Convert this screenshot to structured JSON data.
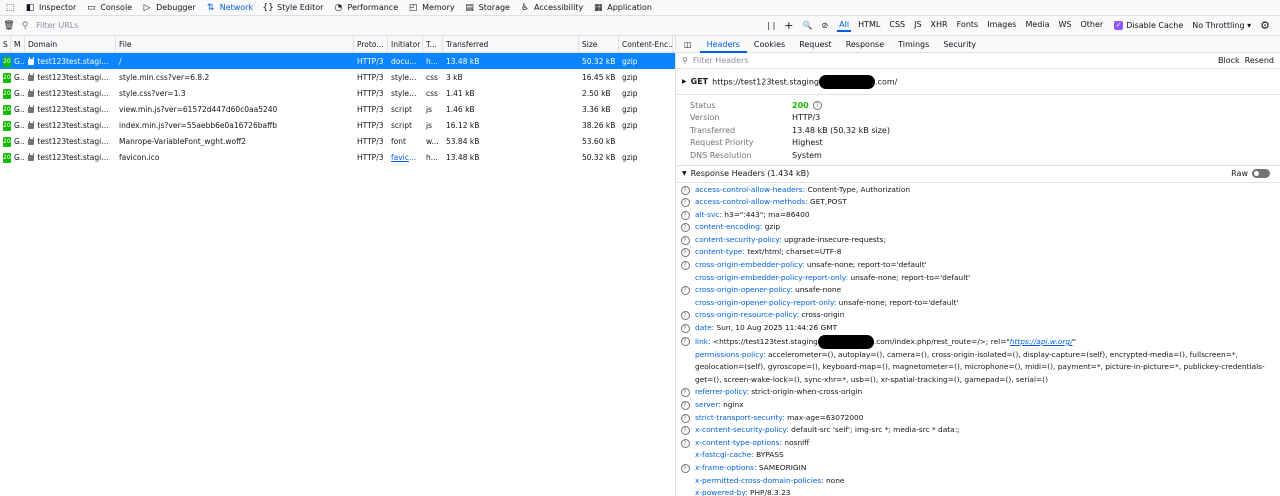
{
  "toolbar": {
    "items": [
      {
        "icon": "pick-element-icon",
        "label": ""
      },
      {
        "icon": "inspector-icon",
        "label": "Inspector"
      },
      {
        "icon": "console-icon",
        "label": "Console"
      },
      {
        "icon": "debugger-icon",
        "label": "Debugger"
      },
      {
        "icon": "network-icon",
        "label": "Network",
        "selected": true
      },
      {
        "icon": "style-editor-icon",
        "label": "Style Editor"
      },
      {
        "icon": "performance-icon",
        "label": "Performance"
      },
      {
        "icon": "memory-icon",
        "label": "Memory"
      },
      {
        "icon": "storage-icon",
        "label": "Storage"
      },
      {
        "icon": "accessibility-icon",
        "label": "Accessibility"
      },
      {
        "icon": "application-icon",
        "label": "Application"
      }
    ]
  },
  "filter": {
    "placeholder": "Filter URLs",
    "types": [
      "All",
      "HTML",
      "CSS",
      "JS",
      "XHR",
      "Fonts",
      "Images",
      "Media",
      "WS",
      "Other"
    ],
    "selected": "All",
    "disable_cache": "Disable Cache",
    "throttling": "No Throttling"
  },
  "table": {
    "columns": [
      "S",
      "M",
      "Domain",
      "File",
      "Proto...",
      "Initiator",
      "T...",
      "Transferred",
      "Size",
      "Content-Enc..."
    ],
    "rows": [
      [
        "200",
        "GET",
        "test123test.staging....",
        "/",
        "HTTP/3",
        "docu...",
        "h...",
        "13.48 kB",
        "50.32 kB",
        "gzip"
      ],
      [
        "200",
        "GET",
        "test123test.staging....",
        "style.min.css?ver=6.8.2",
        "HTTP/3",
        "styles...",
        "css",
        "3 kB",
        "16.45 kB",
        "gzip"
      ],
      [
        "200",
        "GET",
        "test123test.staging....",
        "style.css?ver=1.3",
        "HTTP/3",
        "styles...",
        "css",
        "1.41 kB",
        "2.50 kB",
        "gzip"
      ],
      [
        "200",
        "GET",
        "test123test.staging....",
        "view.min.js?ver=61572d447d60c0aa5240",
        "HTTP/3",
        "script",
        "js",
        "1.46 kB",
        "3.36 kB",
        "gzip"
      ],
      [
        "200",
        "GET",
        "test123test.staging....",
        "index.min.js?ver=55aebb6e0a16726baffb",
        "HTTP/3",
        "script",
        "js",
        "16.12 kB",
        "38.26 kB",
        "gzip"
      ],
      [
        "200",
        "GET",
        "test123test.staging....",
        "Manrope-VariableFont_wght.woff2",
        "HTTP/3",
        "font",
        "w...",
        "53.84 kB",
        "53.60 kB",
        ""
      ],
      [
        "200",
        "GET",
        "test123test.staging....",
        "favicon.ico",
        "HTTP/3",
        "favico...",
        "h...",
        "13.48 kB",
        "50.32 kB",
        "gzip"
      ]
    ]
  },
  "details": {
    "tabs": [
      "Headers",
      "Cookies",
      "Request",
      "Response",
      "Timings",
      "Security"
    ],
    "filter_placeholder": "Filter Headers",
    "block": "Block",
    "resend": "Resend",
    "method": "GET",
    "url_start": "https://test123test.staging",
    "url_end": ".com/",
    "summary": [
      {
        "k": "Status",
        "v": "200"
      },
      {
        "k": "Version",
        "v": "HTTP/3"
      },
      {
        "k": "Transferred",
        "v": "13.48 kB (50.32 kB size)"
      },
      {
        "k": "Request Priority",
        "v": "Highest"
      },
      {
        "k": "DNS Resolution",
        "v": "System"
      }
    ],
    "response_headers_title": "Response Headers (1.434 kB)",
    "raw": "Raw",
    "headers": [
      {
        "k": "access-control-allow-headers:",
        "v": "Content-Type, Authorization",
        "q": true
      },
      {
        "k": "access-control-allow-methods:",
        "v": "GET,POST",
        "q": true
      },
      {
        "k": "alt-svc:",
        "v": "h3=\":443\"; ma=86400",
        "q": true
      },
      {
        "k": "content-encoding:",
        "v": "gzip",
        "q": true
      },
      {
        "k": "content-security-policy:",
        "v": "upgrade-insecure-requests;",
        "q": true
      },
      {
        "k": "content-type:",
        "v": "text/html; charset=UTF-8",
        "q": true
      },
      {
        "k": "cross-origin-embedder-policy:",
        "v": "unsafe-none; report-to='default'",
        "q": true
      },
      {
        "k": "cross-origin-embedder-policy-report-only:",
        "v": "unsafe-none; report-to='default'",
        "q": false
      },
      {
        "k": "cross-origin-opener-policy:",
        "v": "unsafe-none",
        "q": true
      },
      {
        "k": "cross-origin-opener-policy-report-only:",
        "v": "unsafe-none; report-to='default'",
        "q": false
      },
      {
        "k": "cross-origin-resource-policy:",
        "v": "cross-origin",
        "q": true
      },
      {
        "k": "date:",
        "v": "Sun, 10 Aug 2025 11:44:26 GMT",
        "q": true
      },
      {
        "k": "link:",
        "v": "<https://test123test.staging",
        "v2": ".com/index.php/rest_route=/>; rel=\"",
        "v3": "https://api.w.org/",
        "v4": "\"",
        "q": true,
        "redact": true
      },
      {
        "k": "permissions-policy:",
        "v": "accelerometer=(), autoplay=(), camera=(), cross-origin-isolated=(), display-capture=(self), encrypted-media=(), fullscreen=*, geolocation=(self), gyroscope=(), keyboard-map=(), magnetometer=(), microphone=(), midi=(), payment=*, picture-in-picture=*, publickey-credentials-get=(), screen-wake-lock=(), sync-xhr=*, usb=(), xr-spatial-tracking=(), gamepad=(), serial=()",
        "q": false
      },
      {
        "k": "referrer-policy:",
        "v": "strict-origin-when-cross-origin",
        "q": true
      },
      {
        "k": "server:",
        "v": "nginx",
        "q": true
      },
      {
        "k": "strict-transport-security:",
        "v": "max-age=63072000",
        "q": true
      },
      {
        "k": "x-content-security-policy:",
        "v": "default-src 'self'; img-src *; media-src * data:;",
        "q": true
      },
      {
        "k": "x-content-type-options:",
        "v": "nosniff",
        "q": true
      },
      {
        "k": "x-fastcgi-cache:",
        "v": "BYPASS",
        "q": false
      },
      {
        "k": "x-frame-options:",
        "v": "SAMEORIGIN",
        "q": true
      },
      {
        "k": "x-permitted-cross-domain-policies:",
        "v": "none",
        "q": false
      },
      {
        "k": "x-powered-by:",
        "v": "PHP/8.3.23",
        "q": false
      }
    ]
  }
}
